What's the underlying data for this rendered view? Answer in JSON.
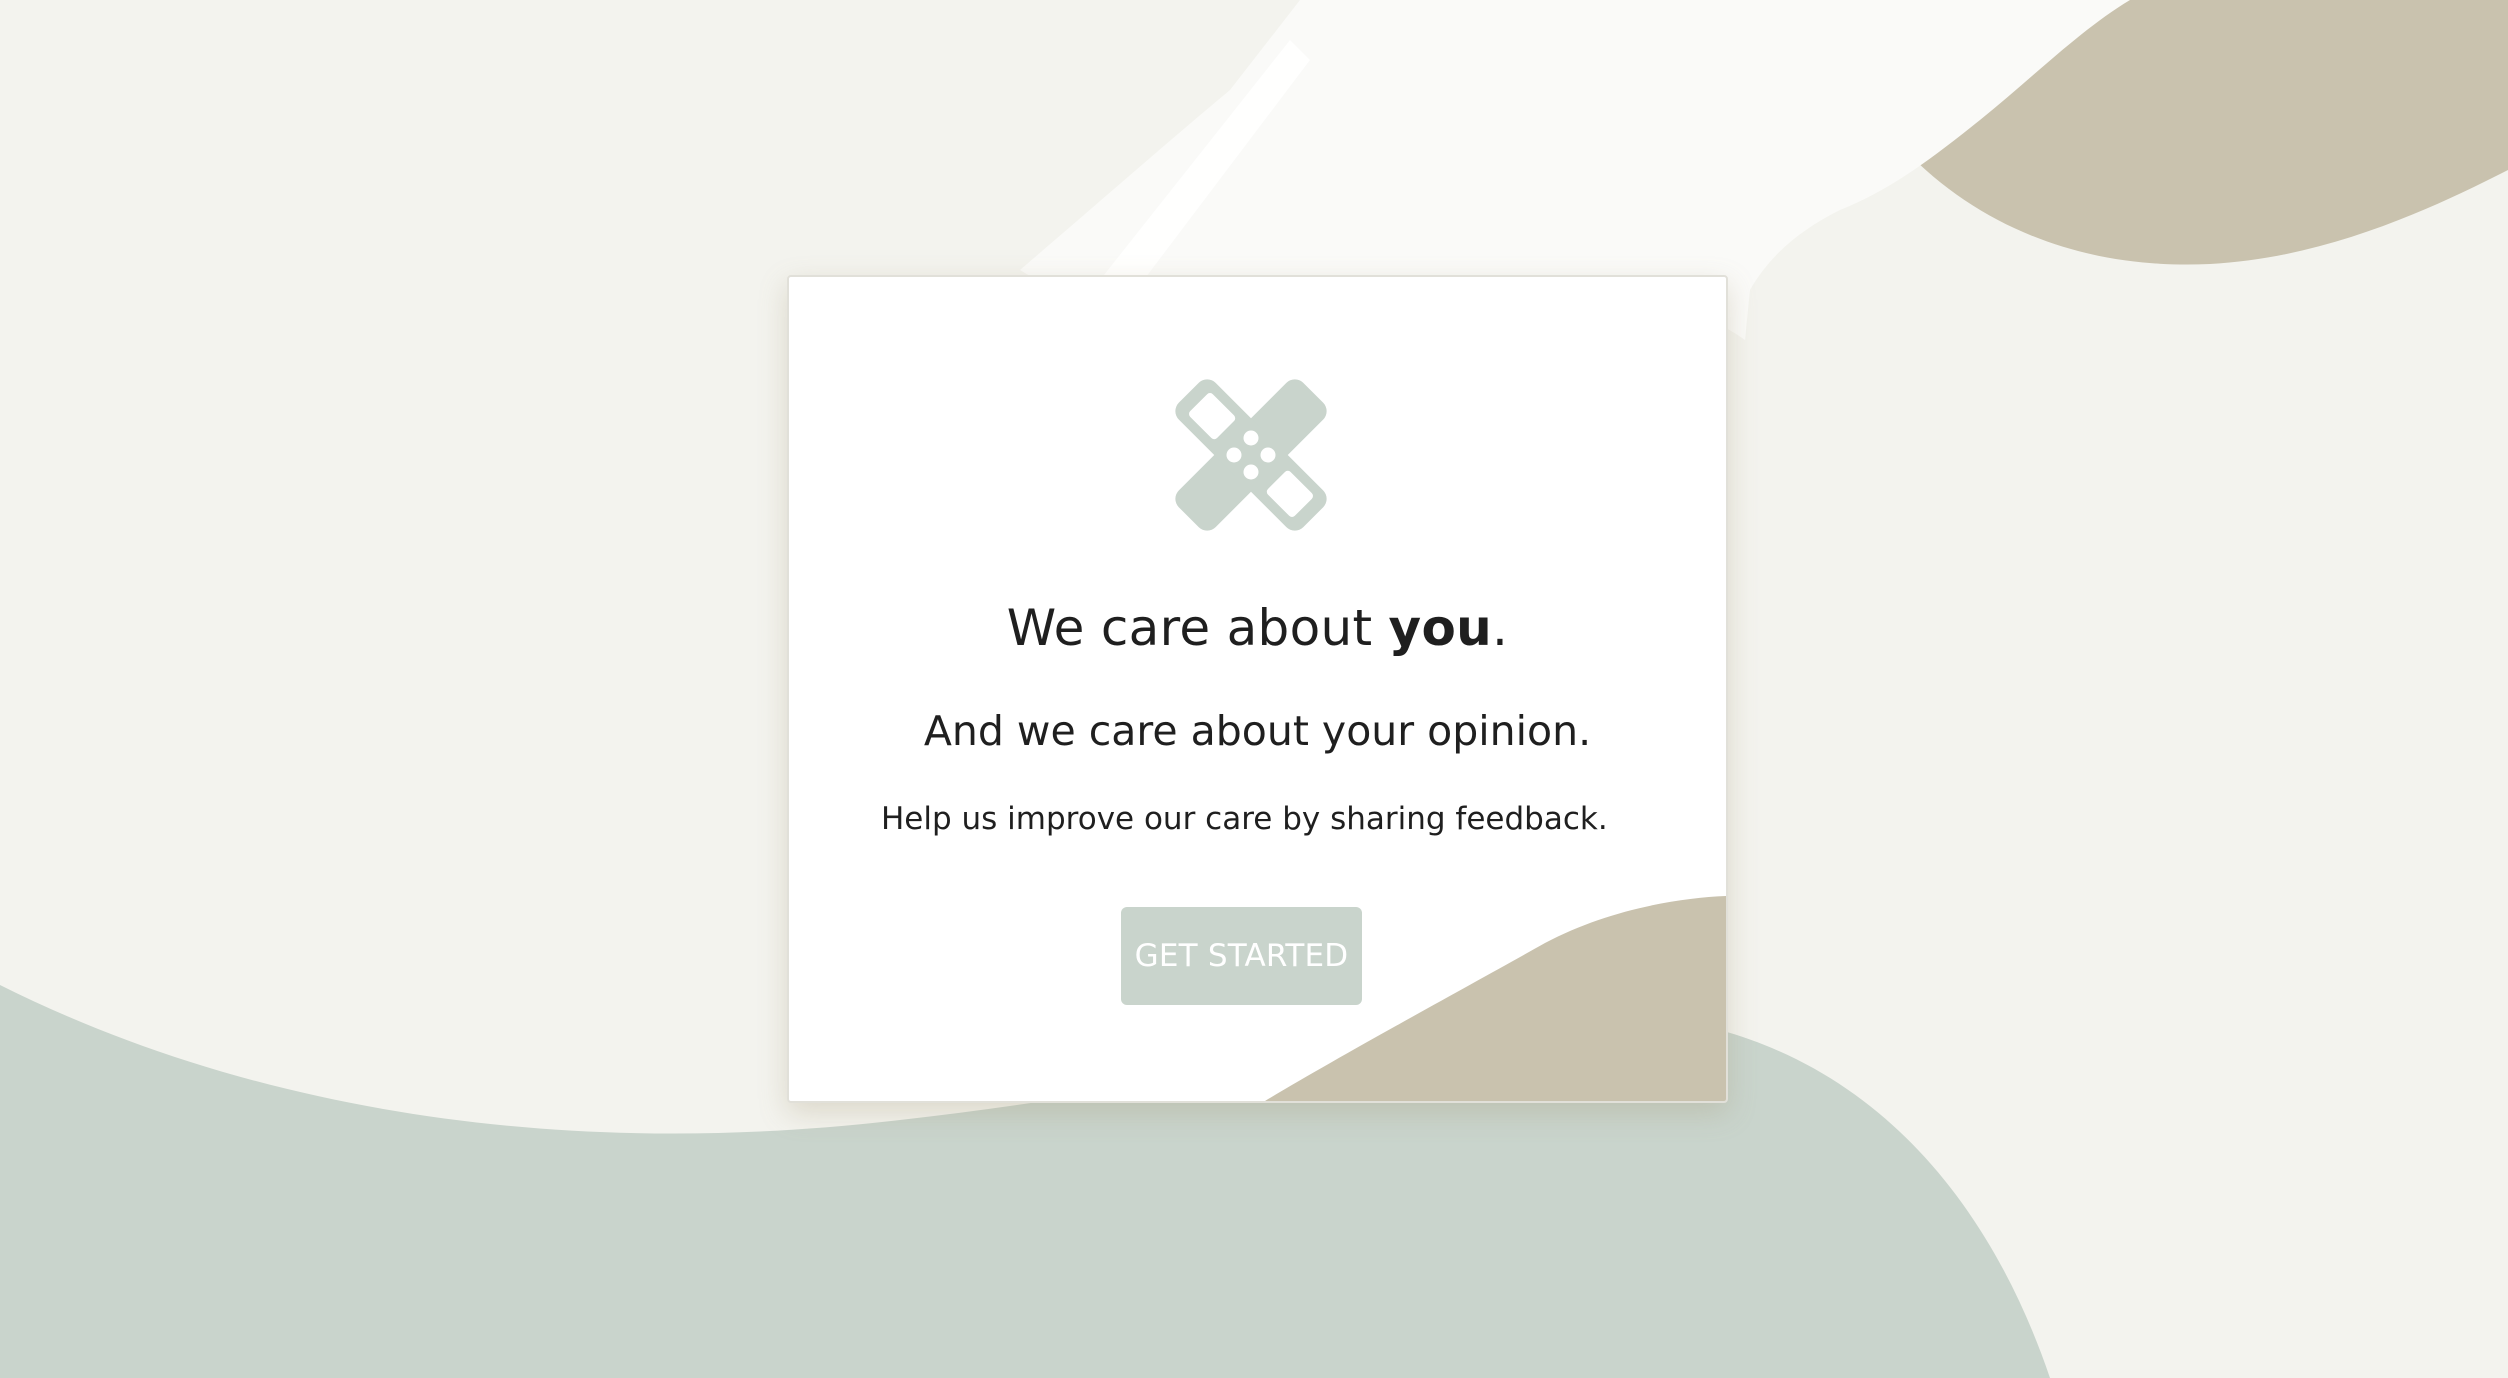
{
  "welcome": {
    "headline_prefix": "We care about ",
    "headline_emphasis": "you",
    "headline_suffix": ".",
    "subheadline": "And we care about your opinion.",
    "help_text": "Help us improve our care by sharing feedback.",
    "cta_label": "GET STARTED"
  },
  "icons": {
    "logo": "bandage-icon"
  },
  "colors": {
    "page_background": "#f3f3ee",
    "sage": "#c9d4cc",
    "sand": "#c9c2ae",
    "card_background": "#ffffff",
    "text": "#1f1f1f",
    "button_text": "#ffffff"
  }
}
